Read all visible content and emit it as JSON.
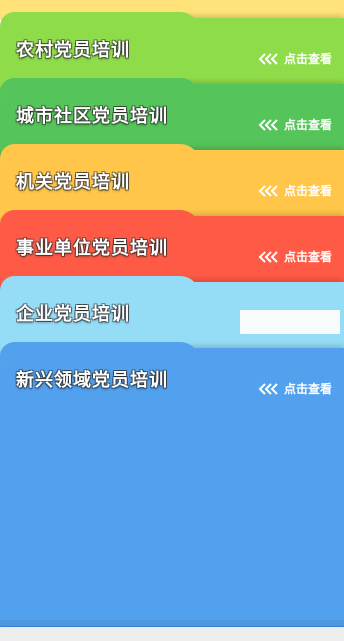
{
  "cards": [
    {
      "title": "农村党员培训",
      "action": "点击查看",
      "color": "#8fdc4b"
    },
    {
      "title": "城市社区党员培训",
      "action": "点击查看",
      "color": "#55c45a"
    },
    {
      "title": "机关党员培训",
      "action": "点击查看",
      "color": "#ffc64a"
    },
    {
      "title": "事业单位党员培训",
      "action": "点击查看",
      "color": "#ff5a46"
    },
    {
      "title": "企业党员培训",
      "action": "",
      "color": "#95dcf6"
    },
    {
      "title": "新兴领域党员培训",
      "action": "点击查看",
      "color": "#52a1ef"
    }
  ],
  "colors": {
    "top_strip": "#ffe27a",
    "bottom_bar": "#3d86d6"
  }
}
